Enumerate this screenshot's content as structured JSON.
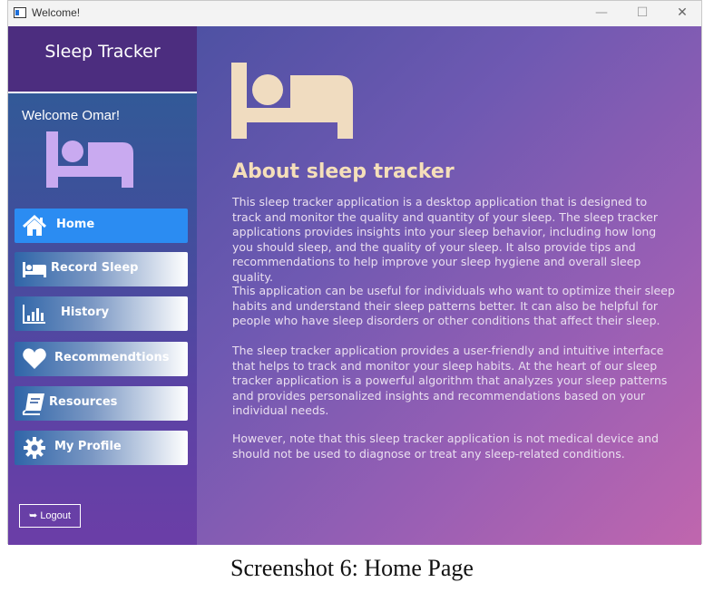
{
  "window": {
    "title": "Welcome!",
    "controls": {
      "minimize": "—",
      "maximize": "☐",
      "close": "✕"
    }
  },
  "sidebar": {
    "brand": "Sleep Tracker",
    "welcome": "Welcome Omar!",
    "items": [
      {
        "label": "Home",
        "icon": "home-icon",
        "active": true
      },
      {
        "label": "Record Sleep",
        "icon": "bed-icon",
        "active": false
      },
      {
        "label": "History",
        "icon": "bar-chart-icon",
        "active": false
      },
      {
        "label": "Recommendtions",
        "icon": "heart-icon",
        "active": false
      },
      {
        "label": "Resources",
        "icon": "book-icon",
        "active": false
      },
      {
        "label": "My Profile",
        "icon": "gear-icon",
        "active": false
      }
    ],
    "logout": "Logout"
  },
  "main": {
    "title": "About sleep tracker",
    "paragraphs": [
      "This sleep tracker application is a desktop application that is designed to track and monitor the quality and quantity of your sleep. The sleep tracker applications provides insights into your sleep behavior,  including how long you should sleep, and the quality of your sleep. It also provide tips and recommendations to help improve your sleep hygiene and overall sleep quality.",
      "This application can be useful for individuals who want to optimize their sleep habits and understand their sleep patterns better. It can also be helpful for people who have sleep disorders or other conditions that affect their sleep.",
      "The sleep tracker application provides a user-friendly and intuitive interface that helps to track and monitor your sleep habits. At the heart of our sleep tracker application is a powerful algorithm that analyzes your sleep patterns and provides personalized insights and recommendations based on your individual needs.",
      "However, note that this sleep tracker application is not medical device and should not be used to diagnose or treat any sleep-related conditions."
    ]
  },
  "caption": "Screenshot 6: Home Page",
  "colors": {
    "accent": "#2b8cf2",
    "title": "#f5dfba",
    "bed_hero": "#f0dcc0",
    "bed_side": "#c9aaf0"
  }
}
